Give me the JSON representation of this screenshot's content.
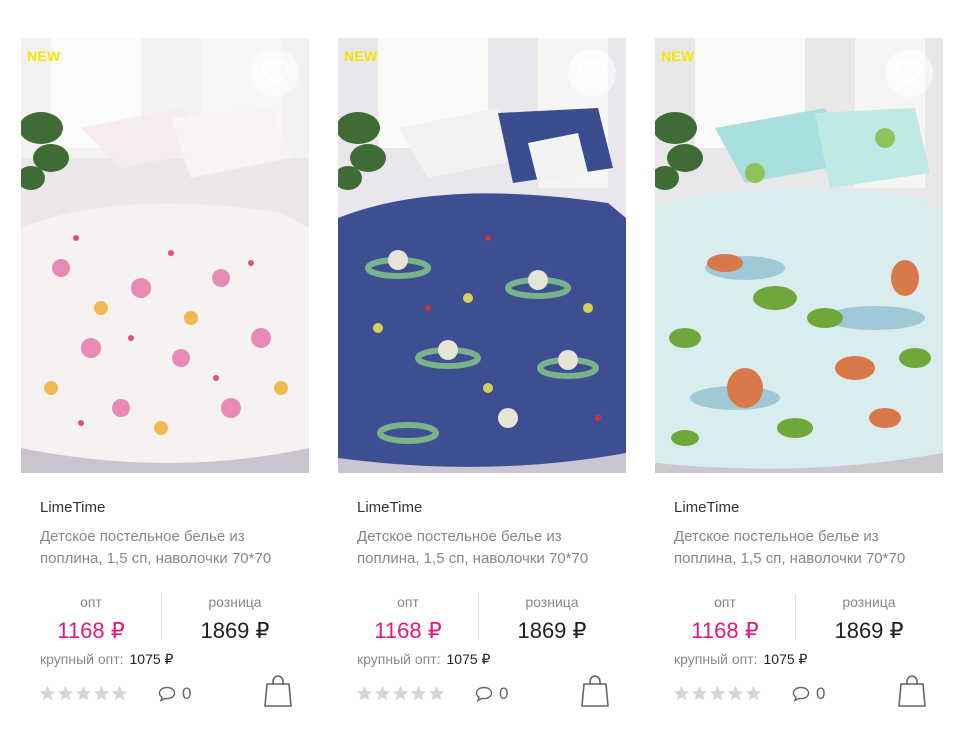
{
  "products": [
    {
      "badge": "NEW",
      "brand": "LimeTime",
      "title": "Детское постельное белье из поплина, 1,5 сп, наволочки 70*70",
      "opt_label": "опт",
      "retail_label": "розница",
      "opt_price": "1168 ₽",
      "retail_price": "1869 ₽",
      "bulk_label": "крупный опт:",
      "bulk_price": "1075 ₽",
      "rating": 0,
      "comments": "0",
      "pattern": "ballerina",
      "icons": {
        "favorite": "heart-icon",
        "comment": "speech-bubble-icon",
        "cart": "shopping-bag-icon",
        "rating": "star-icon"
      }
    },
    {
      "badge": "NEW",
      "brand": "LimeTime",
      "title": "Детское постельное белье из поплина, 1,5 сп, наволочки 70*70",
      "opt_label": "опт",
      "retail_label": "розница",
      "opt_price": "1168 ₽",
      "retail_price": "1869 ₽",
      "bulk_label": "крупный опт:",
      "bulk_price": "1075 ₽",
      "rating": 0,
      "comments": "0",
      "pattern": "space",
      "icons": {
        "favorite": "heart-icon",
        "comment": "speech-bubble-icon",
        "cart": "shopping-bag-icon",
        "rating": "star-icon"
      }
    },
    {
      "badge": "NEW",
      "brand": "LimeTime",
      "title": "Детское постельное белье из поплина, 1,5 сп, наволочки 70*70",
      "opt_label": "опт",
      "retail_label": "розница",
      "opt_price": "1168 ₽",
      "retail_price": "1869 ₽",
      "bulk_label": "крупный опт:",
      "bulk_price": "1075 ₽",
      "rating": 0,
      "comments": "0",
      "pattern": "dinosaur",
      "icons": {
        "favorite": "heart-icon",
        "comment": "speech-bubble-icon",
        "cart": "shopping-bag-icon",
        "rating": "star-icon"
      }
    }
  ],
  "colors": {
    "opt_price": "#e8177d",
    "badge": "#f2e600",
    "star_empty": "#d6d6d6"
  }
}
